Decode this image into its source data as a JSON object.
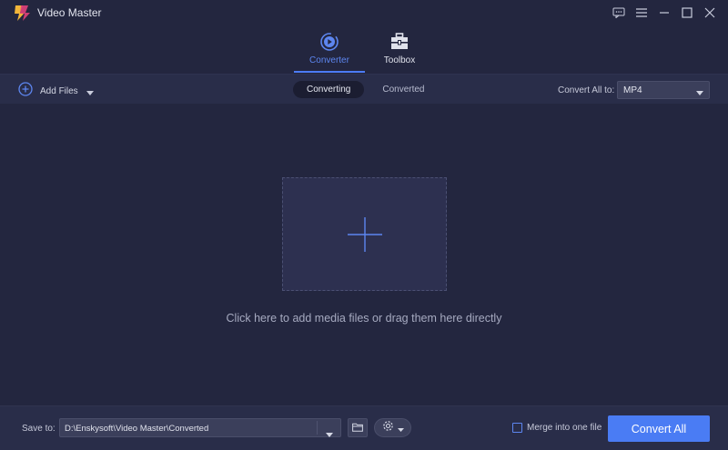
{
  "app": {
    "title": "Video Master"
  },
  "main_tabs": [
    {
      "label": "Converter",
      "icon": "converter-icon",
      "active": true
    },
    {
      "label": "Toolbox",
      "icon": "toolbox-icon",
      "active": false
    }
  ],
  "toolbar": {
    "add_files_label": "Add Files",
    "sub_tabs": [
      {
        "label": "Converting",
        "active": true
      },
      {
        "label": "Converted",
        "active": false
      }
    ],
    "convert_all_to_label": "Convert All to:",
    "format_value": "MP4"
  },
  "drop_zone": {
    "hint": "Click here to add media files or drag them here directly"
  },
  "bottom": {
    "save_to_label": "Save to:",
    "save_path": "D:\\Enskysoft\\Video Master\\Converted",
    "merge_label": "Merge into one file",
    "merge_checked": false,
    "convert_all_label": "Convert All"
  },
  "colors": {
    "background": "#23263f",
    "accent": "#4a7cf4",
    "bar": "#292d49"
  }
}
